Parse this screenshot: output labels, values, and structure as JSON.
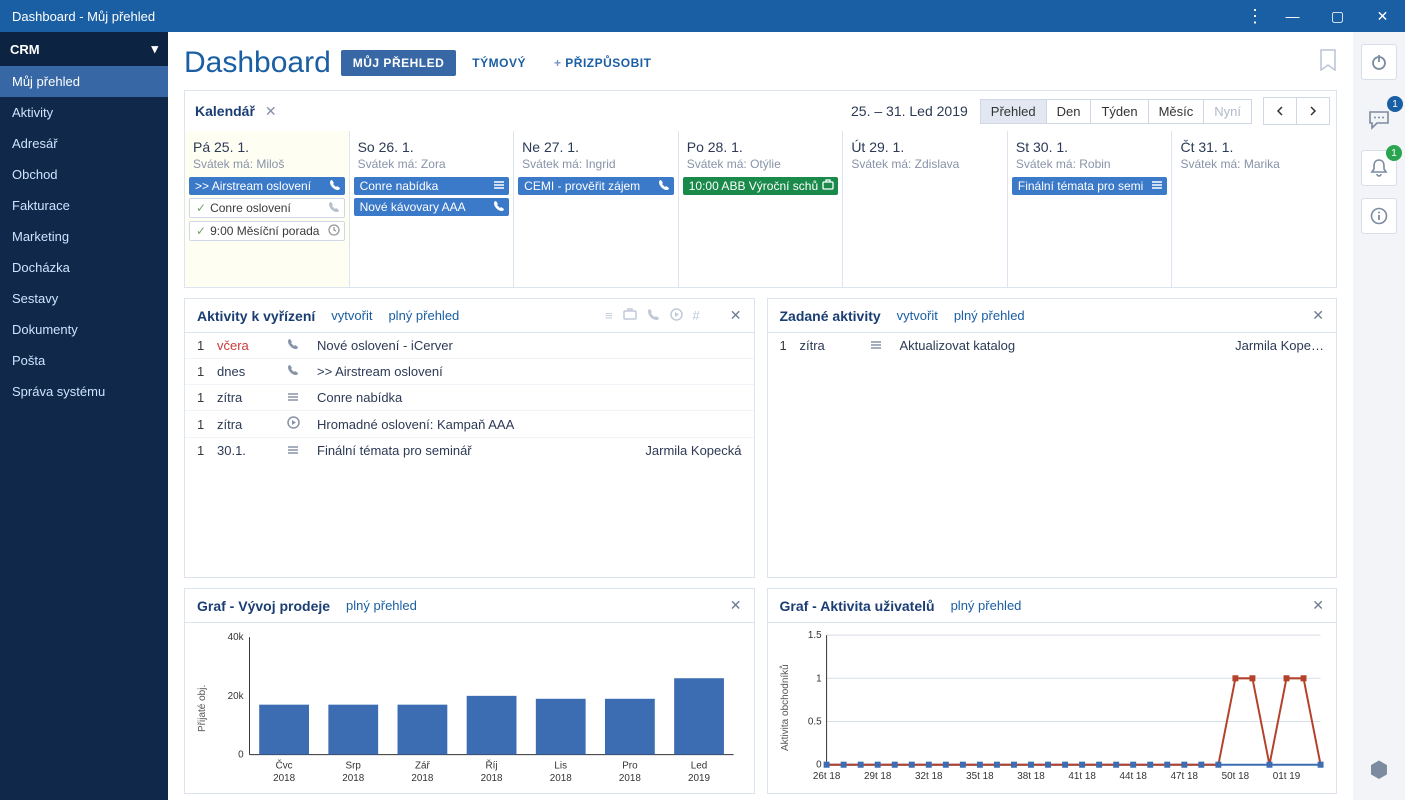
{
  "title": "Dashboard - Můj přehled",
  "sidebar": {
    "head": "CRM",
    "items": [
      {
        "label": "Můj přehled",
        "active": true
      },
      {
        "label": "Aktivity"
      },
      {
        "label": "Adresář"
      },
      {
        "label": "Obchod"
      },
      {
        "label": "Fakturace"
      },
      {
        "label": "Marketing"
      },
      {
        "label": "Docházka"
      },
      {
        "label": "Sestavy"
      },
      {
        "label": "Dokumenty"
      },
      {
        "label": "Pošta"
      },
      {
        "label": "Správa systému"
      }
    ]
  },
  "header": {
    "title": "Dashboard",
    "tabs": [
      {
        "label": "MŮJ PŘEHLED",
        "active": true
      },
      {
        "label": "TÝMOVÝ"
      },
      {
        "label": "PŘIZPŮSOBIT",
        "plus": true
      }
    ]
  },
  "calendar": {
    "title": "Kalendář",
    "range": "25. – 31. Led 2019",
    "views": [
      "Přehled",
      "Den",
      "Týden",
      "Měsíc",
      "Nyní"
    ],
    "active_view": "Přehled",
    "disabled_view": "Nyní",
    "days": [
      {
        "label": "Pá 25. 1.",
        "svatek": "Svátek má: Miloš",
        "events": [
          {
            "text": ">> Airstream oslovení",
            "style": "blue",
            "icon": "phone"
          },
          {
            "text": "Conre oslovení",
            "style": "white",
            "check": true,
            "icon": "phone-dim"
          },
          {
            "text": "9:00 Měsíční porada",
            "style": "white",
            "check": true,
            "icon": "clock"
          }
        ]
      },
      {
        "label": "So 26. 1.",
        "svatek": "Svátek má: Zora",
        "events": [
          {
            "text": "Conre nabídka",
            "style": "blue",
            "icon": "list"
          },
          {
            "text": "Nové kávovary AAA",
            "style": "blue",
            "icon": "phone"
          }
        ]
      },
      {
        "label": "Ne 27. 1.",
        "svatek": "Svátek má: Ingrid",
        "events": [
          {
            "text": "CEMI - prověřit zájem",
            "style": "blue",
            "icon": "phone"
          }
        ]
      },
      {
        "label": "Po 28. 1.",
        "svatek": "Svátek má: Otýlie",
        "events": [
          {
            "text": "10:00 ABB Výroční schů",
            "style": "green",
            "icon": "briefcase"
          }
        ]
      },
      {
        "label": "Út 29. 1.",
        "svatek": "Svátek má: Zdislava",
        "events": []
      },
      {
        "label": "St 30. 1.",
        "svatek": "Svátek má: Robin",
        "events": [
          {
            "text": "Finální témata pro semi",
            "style": "blue",
            "icon": "list"
          }
        ]
      },
      {
        "label": "Čt 31. 1.",
        "svatek": "Svátek má: Marika",
        "events": []
      }
    ]
  },
  "activities_to_do": {
    "title": "Aktivity k vyřízení",
    "create": "vytvořit",
    "full": "plný přehled",
    "rows": [
      {
        "idx": "1",
        "time": "včera",
        "time_red": true,
        "icon": "phone",
        "desc": "Nové oslovení - iCerver",
        "who": ""
      },
      {
        "idx": "1",
        "time": "dnes",
        "icon": "phone",
        "desc": ">> Airstream oslovení",
        "who": ""
      },
      {
        "idx": "1",
        "time": "zítra",
        "icon": "list",
        "desc": "Conre nabídka",
        "who": ""
      },
      {
        "idx": "1",
        "time": "zítra",
        "icon": "play",
        "desc": "Hromadné oslovení: Kampaň AAA",
        "who": ""
      },
      {
        "idx": "1",
        "time": "30.1.",
        "icon": "list",
        "desc": "Finální témata pro seminář",
        "who": "Jarmila Kopecká"
      }
    ]
  },
  "activities_assigned": {
    "title": "Zadané aktivity",
    "create": "vytvořit",
    "full": "plný přehled",
    "rows": [
      {
        "idx": "1",
        "time": "zítra",
        "icon": "list",
        "desc": "Aktualizovat katalog",
        "who": "Jarmila Kope…"
      }
    ]
  },
  "chart_sales": {
    "title": "Graf - Vývoj prodeje",
    "full": "plný přehled"
  },
  "chart_users": {
    "title": "Graf - Aktivita uživatelů",
    "full": "plný přehled"
  },
  "rightbar": {
    "chat_badge": "1",
    "bell_badge": "1"
  },
  "chart_data": [
    {
      "id": "sales",
      "type": "bar",
      "title": "Graf - Vývoj prodeje",
      "ylabel": "Přijaté obj.",
      "categories": [
        "Čvc 2018",
        "Srp 2018",
        "Zář 2018",
        "Říj 2018",
        "Lis 2018",
        "Pro 2018",
        "Led 2019"
      ],
      "values": [
        17000,
        17000,
        17000,
        20000,
        19000,
        19000,
        26000
      ],
      "ylim": [
        0,
        40000
      ],
      "yticks": [
        0,
        20000,
        40000
      ],
      "ytick_labels": [
        "0",
        "20k",
        "40k"
      ]
    },
    {
      "id": "users",
      "type": "line",
      "title": "Graf - Aktivita uživatelů",
      "ylabel": "Aktivita obchodníků",
      "x": [
        "26t 18",
        "27t 18",
        "28t 18",
        "29t 18",
        "30t 18",
        "31t 18",
        "32t 18",
        "33t 18",
        "34t 18",
        "35t 18",
        "36t 18",
        "37t 18",
        "38t 18",
        "39t 18",
        "40t 18",
        "41t 18",
        "42t 18",
        "43t 18",
        "44t 18",
        "45t 18",
        "46t 18",
        "47t 18",
        "48t 18",
        "49t 18",
        "50t 18",
        "51t 18",
        "52t 18",
        "01t 19",
        "02t 19",
        "03t 19"
      ],
      "series": [
        {
          "name": "blue",
          "color": "#3c6db3",
          "marker": "square",
          "values": [
            0,
            0,
            0,
            0,
            0,
            0,
            0,
            0,
            0,
            0,
            0,
            0,
            0,
            0,
            0,
            0,
            0,
            0,
            0,
            0,
            0,
            0,
            0,
            0,
            0,
            0,
            0,
            0,
            0,
            0
          ]
        },
        {
          "name": "red",
          "color": "#b4412a",
          "marker": "square",
          "values": [
            0,
            0,
            0,
            0,
            0,
            0,
            0,
            0,
            0,
            0,
            0,
            0,
            0,
            0,
            0,
            0,
            0,
            0,
            0,
            0,
            0,
            0,
            0,
            0,
            1,
            1,
            0,
            1,
            1,
            0
          ]
        }
      ],
      "ylim": [
        0,
        1.5
      ],
      "yticks": [
        0,
        0.5,
        1,
        1.5
      ],
      "xticks_shown": [
        "26t 18",
        "29t 18",
        "32t 18",
        "35t 18",
        "38t 18",
        "41t 18",
        "44t 18",
        "47t 18",
        "50t 18",
        "01t 19"
      ]
    }
  ]
}
